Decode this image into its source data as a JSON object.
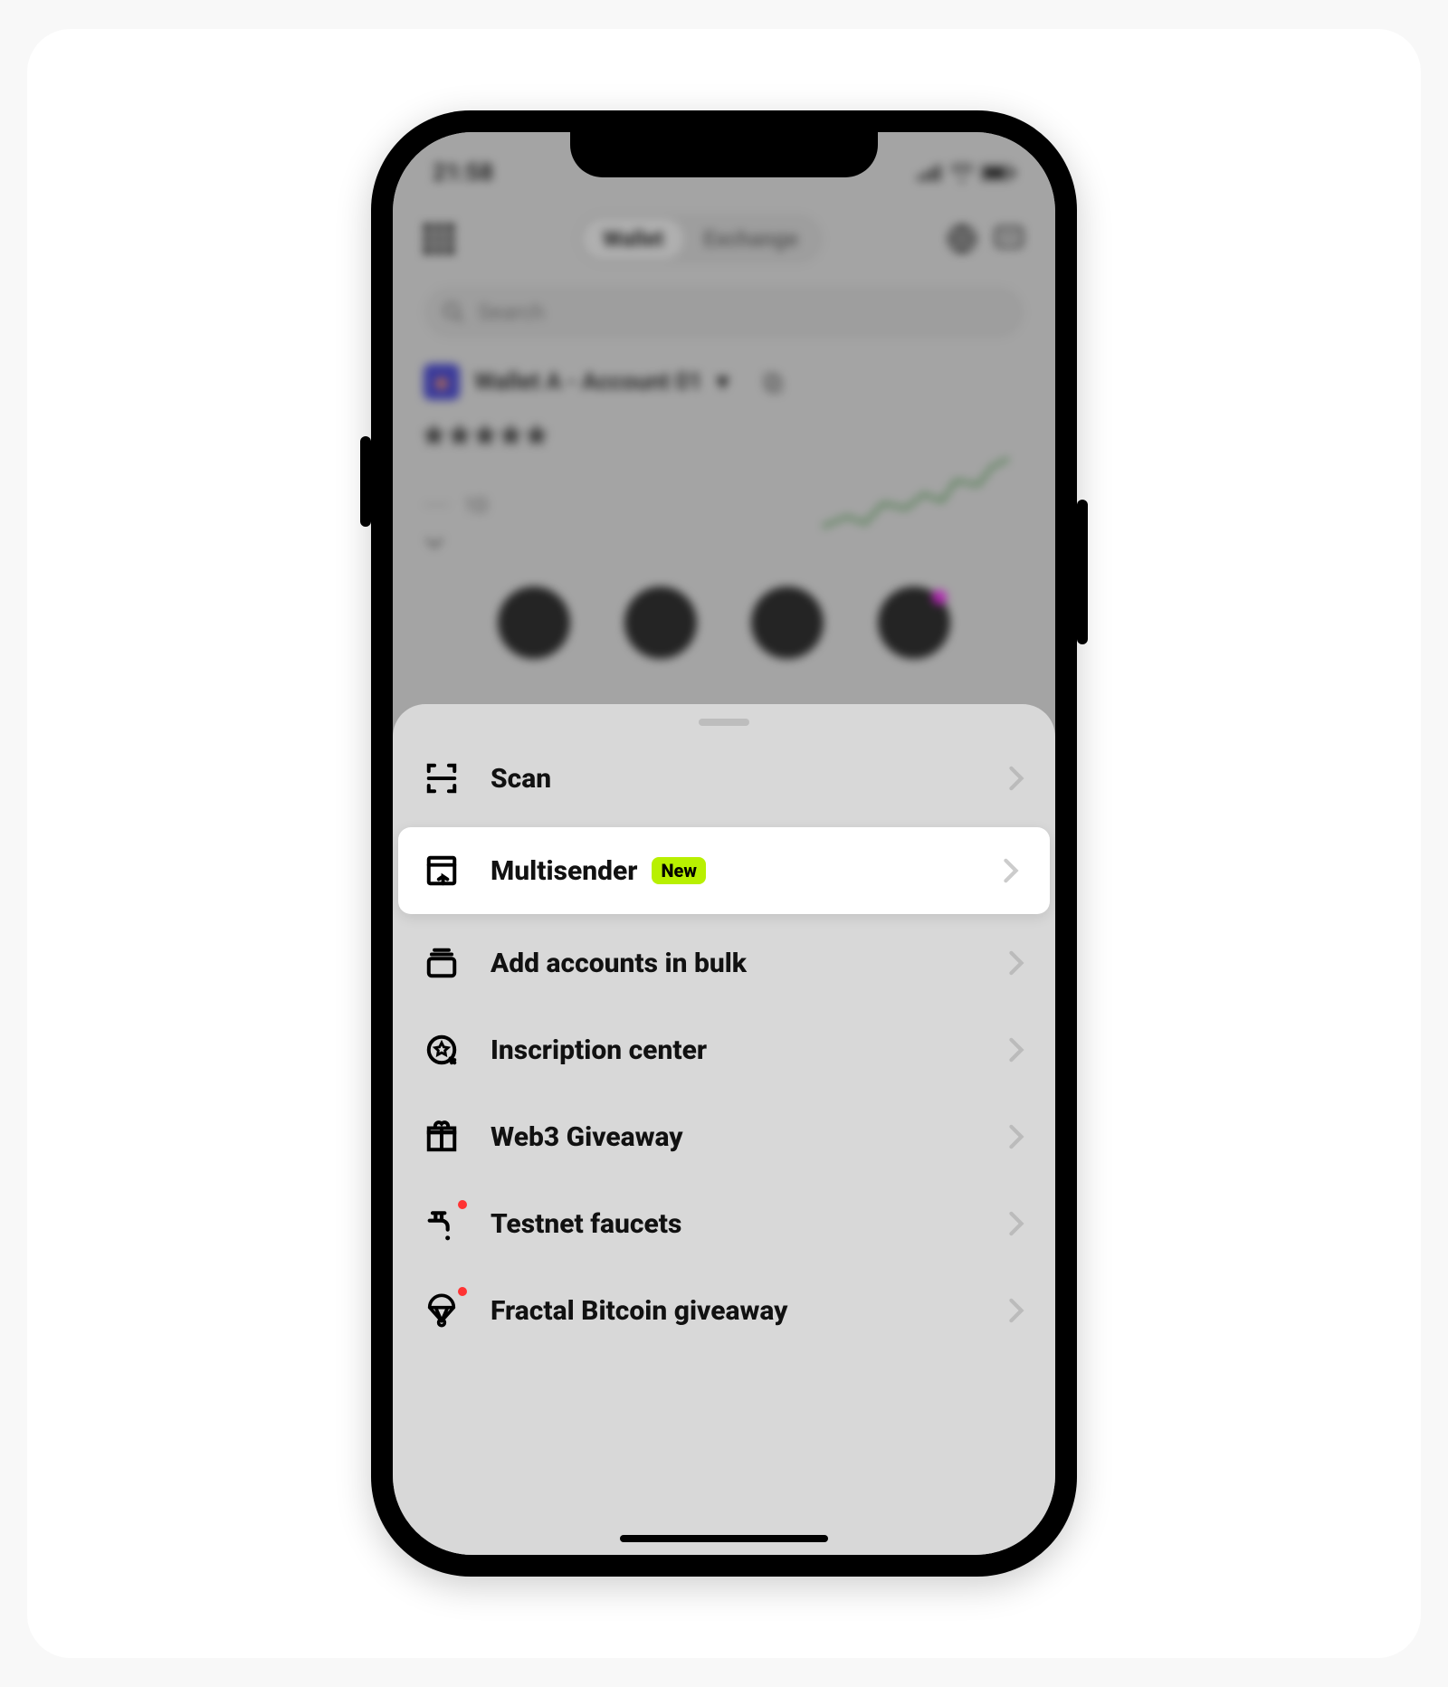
{
  "status": {
    "time": "21:58"
  },
  "tabs": {
    "wallet": "Wallet",
    "exchange": "Exchange"
  },
  "search": {
    "placeholder": "Search"
  },
  "account": {
    "label": "Wallet A - Account 01"
  },
  "balance": {
    "masked": "*****",
    "change_masked": "·····",
    "period": "1D"
  },
  "sheet": {
    "items": [
      {
        "label": "Scan"
      },
      {
        "label": "Multisender",
        "badge": "New"
      },
      {
        "label": "Add accounts in bulk"
      },
      {
        "label": "Inscription center"
      },
      {
        "label": "Web3 Giveaway"
      },
      {
        "label": "Testnet faucets"
      },
      {
        "label": "Fractal Bitcoin giveaway"
      }
    ]
  }
}
